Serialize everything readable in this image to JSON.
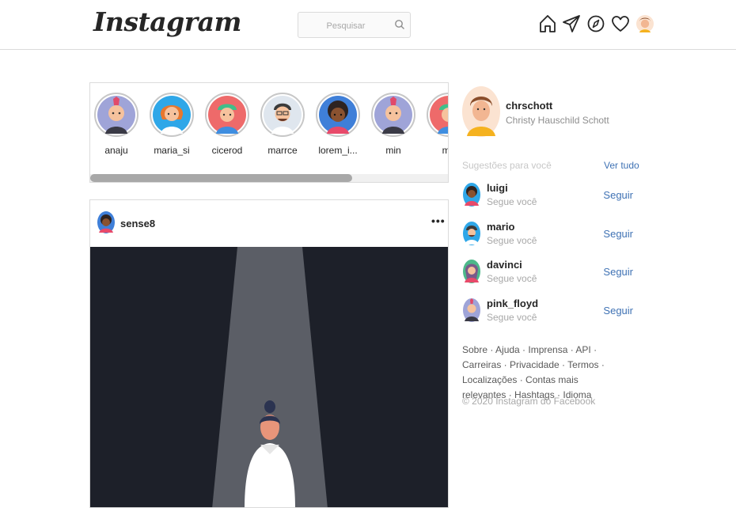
{
  "app": {
    "logo": "Instagram"
  },
  "search": {
    "placeholder": "Pesquisar"
  },
  "nav": {
    "icons": [
      "home-icon",
      "direct-icon",
      "explore-icon",
      "heart-icon",
      "profile-avatar"
    ]
  },
  "stories": [
    {
      "username": "anaju"
    },
    {
      "username": "maria_si"
    },
    {
      "username": "cicerod"
    },
    {
      "username": "marrce"
    },
    {
      "username": "lorem_i..."
    },
    {
      "username": "min"
    },
    {
      "username": "ma"
    }
  ],
  "post": {
    "username": "sense8",
    "more_label": "•••"
  },
  "sidebar": {
    "username": "chrschott",
    "full_name": "Christy Hauschild Schott",
    "suggestions_title": "Sugestões para você",
    "see_all": "Ver tudo",
    "suggestions": [
      {
        "username": "luigi",
        "desc": "Segue você",
        "action": "Seguir"
      },
      {
        "username": "mario",
        "desc": "Segue você",
        "action": "Seguir"
      },
      {
        "username": "davinci",
        "desc": "Segue você",
        "action": "Seguir"
      },
      {
        "username": "pink_floyd",
        "desc": "Segue você",
        "action": "Seguir"
      }
    ],
    "footer_links": "Sobre · Ajuda · Imprensa · API · Carreiras · Privacidade · Termos · Localizações · Contas mais relevantes · Hashtags · Idioma",
    "copyright": "© 2020 Instagram do Facebook"
  },
  "colors": {
    "link": "#3f72b4",
    "border": "#dbdbdb",
    "post_bg": "#1d2029"
  }
}
